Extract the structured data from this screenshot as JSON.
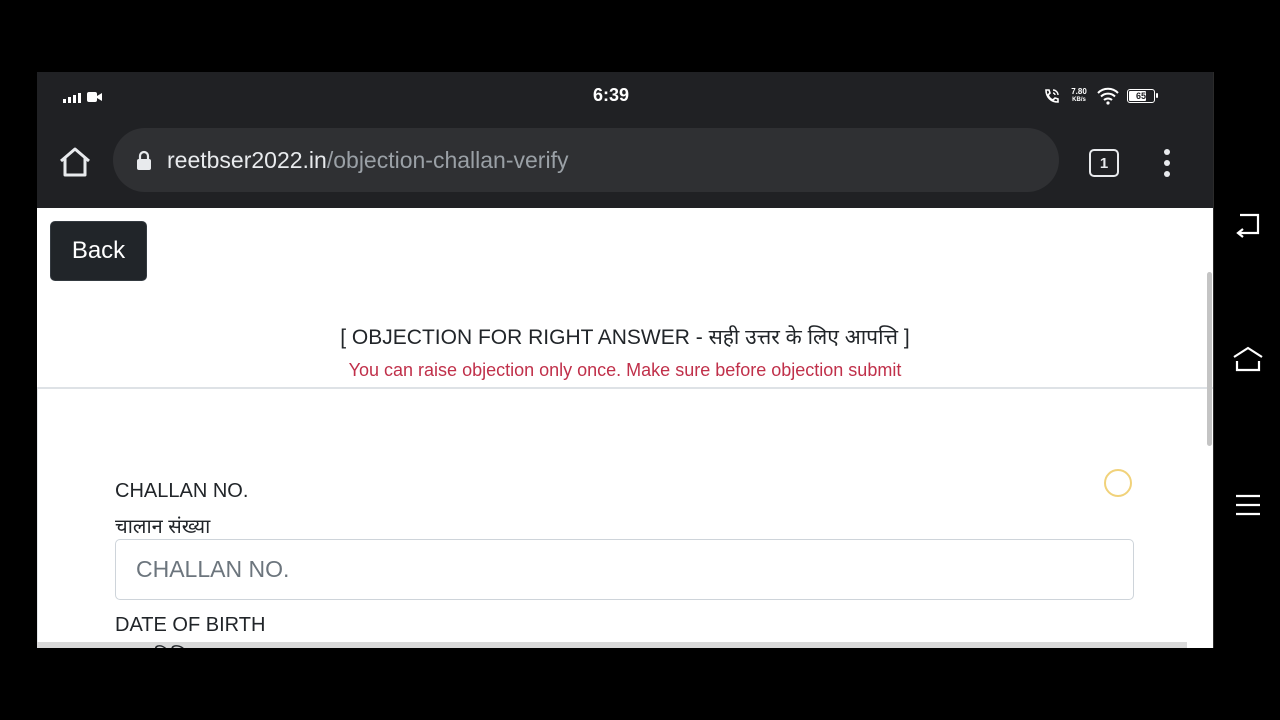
{
  "status_bar": {
    "time": "6:39",
    "net_speed_value": "7.80",
    "net_speed_unit": "KB/s",
    "battery": "65",
    "battery_fraction": 0.65
  },
  "browser": {
    "url_host": "reetbser2022.in",
    "url_path": "/objection-challan-verify",
    "tab_count": "1"
  },
  "page": {
    "back_label": "Back",
    "objection_title": "[ OBJECTION FOR RIGHT ANSWER - सही उत्तर के लिए आपत्ति ]",
    "objection_note": "You can raise objection only once. Make sure before objection submit",
    "challan_label_en": "CHALLAN NO.",
    "challan_label_hi": "चालान संख्या",
    "challan_placeholder": "CHALLAN NO.",
    "challan_value": "",
    "dob_label_en": "DATE OF BIRTH",
    "dob_label_hi": "जन्म तिथि"
  },
  "icons": {
    "home": "home-icon",
    "lock": "lock-icon",
    "menu": "more-vert-icon",
    "nav_back": "back-arrow-icon",
    "nav_home": "home-nav-icon",
    "nav_recents": "recents-icon"
  }
}
